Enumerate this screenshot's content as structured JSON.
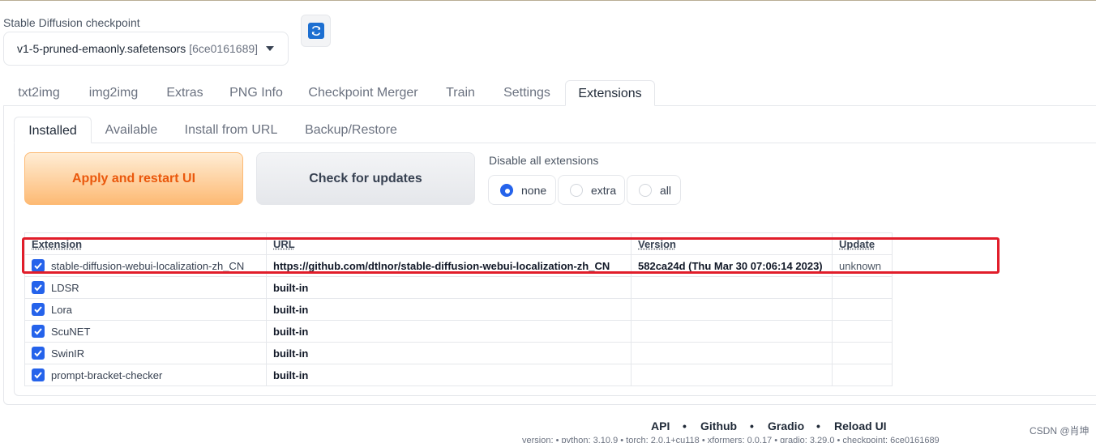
{
  "checkpoint": {
    "label": "Stable Diffusion checkpoint",
    "value": "v1-5-pruned-emaonly.safetensors",
    "hash": "[6ce0161689]"
  },
  "main_tabs": [
    "txt2img",
    "img2img",
    "Extras",
    "PNG Info",
    "Checkpoint Merger",
    "Train",
    "Settings",
    "Extensions"
  ],
  "sub_tabs": [
    "Installed",
    "Available",
    "Install from URL",
    "Backup/Restore"
  ],
  "actions": {
    "apply_label": "Apply and restart UI",
    "check_label": "Check for updates"
  },
  "disable": {
    "label": "Disable all extensions",
    "options": [
      "none",
      "extra",
      "all"
    ],
    "selected": "none"
  },
  "table": {
    "headers": [
      "Extension",
      "URL",
      "Version",
      "Update"
    ],
    "rows": [
      {
        "name": "stable-diffusion-webui-localization-zh_CN",
        "url": "https://github.com/dtlnor/stable-diffusion-webui-localization-zh_CN",
        "version": "582ca24d (Thu Mar 30 07:06:14 2023)",
        "update": "unknown",
        "checked": true
      },
      {
        "name": "LDSR",
        "url": "built-in",
        "version": "",
        "update": "",
        "checked": true
      },
      {
        "name": "Lora",
        "url": "built-in",
        "version": "",
        "update": "",
        "checked": true
      },
      {
        "name": "ScuNET",
        "url": "built-in",
        "version": "",
        "update": "",
        "checked": true
      },
      {
        "name": "SwinIR",
        "url": "built-in",
        "version": "",
        "update": "",
        "checked": true
      },
      {
        "name": "prompt-bracket-checker",
        "url": "built-in",
        "version": "",
        "update": "",
        "checked": true
      }
    ]
  },
  "footer": {
    "links": [
      "API",
      "Github",
      "Gradio",
      "Reload UI"
    ],
    "separator": "•",
    "versions": "version: • python: 3.10.9 • torch: 2.0.1+cu118 • xformers: 0.0.17 • gradio: 3.29.0 • checkpoint: 6ce0161689"
  },
  "watermark": "CSDN @肖坤",
  "colors": {
    "accent": "#2563eb",
    "apply_text": "#ea580c",
    "highlight": "#e11d2a"
  }
}
